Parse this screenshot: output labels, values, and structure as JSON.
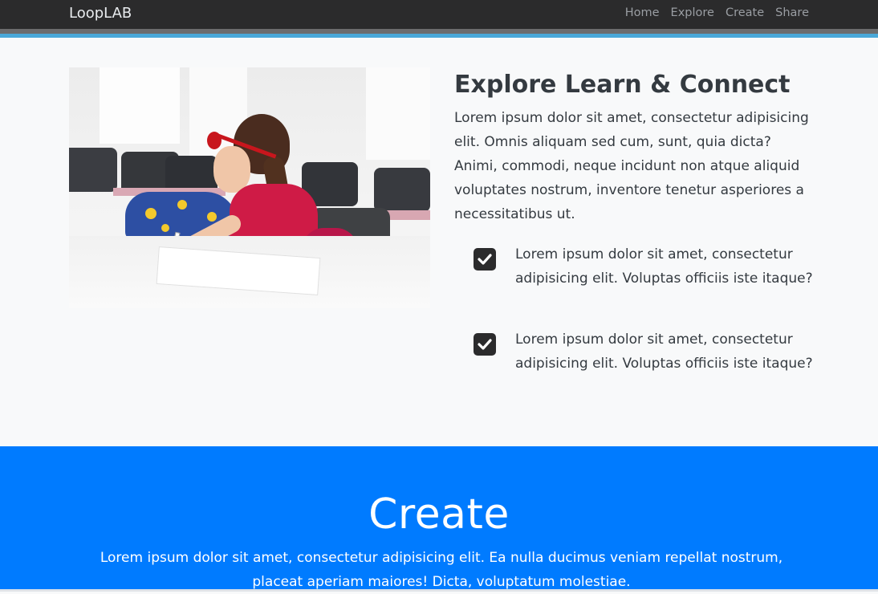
{
  "navbar": {
    "brand": "LoopLAB",
    "links": [
      "Home",
      "Explore",
      "Create",
      "Share"
    ]
  },
  "explore": {
    "image_alt": "Child drawing on paper at a table in a classroom",
    "title": "Explore Learn & Connect",
    "body": "Lorem ipsum dolor sit amet, consectetur adipisicing elit. Omnis aliquam sed cum, sunt, quia dicta? Animi, commodi, neque incidunt non atque aliquid voluptates nostrum, inventore tenetur asperiores a necessitatibus ut.",
    "checklist": [
      {
        "icon": "check-square-icon",
        "text": "Lorem ipsum dolor sit amet, consectetur adipisicing elit. Voluptas officiis iste itaque?"
      },
      {
        "icon": "check-square-icon",
        "text": "Lorem ipsum dolor sit amet, consectetur adipisicing elit. Voluptas officiis iste itaque?"
      }
    ]
  },
  "create": {
    "title": "Create",
    "body": "Lorem ipsum dolor sit amet, consectetur adipisicing elit. Ea nulla ducimus veniam repellat nostrum, placeat aperiam maiores! Dicta, voluptatum molestiae."
  },
  "colors": {
    "navbar_bg": "#2b2b2c",
    "accent_blue": "#4aa8d8",
    "create_bg": "#007bff",
    "page_bg": "#f8f9fa"
  }
}
